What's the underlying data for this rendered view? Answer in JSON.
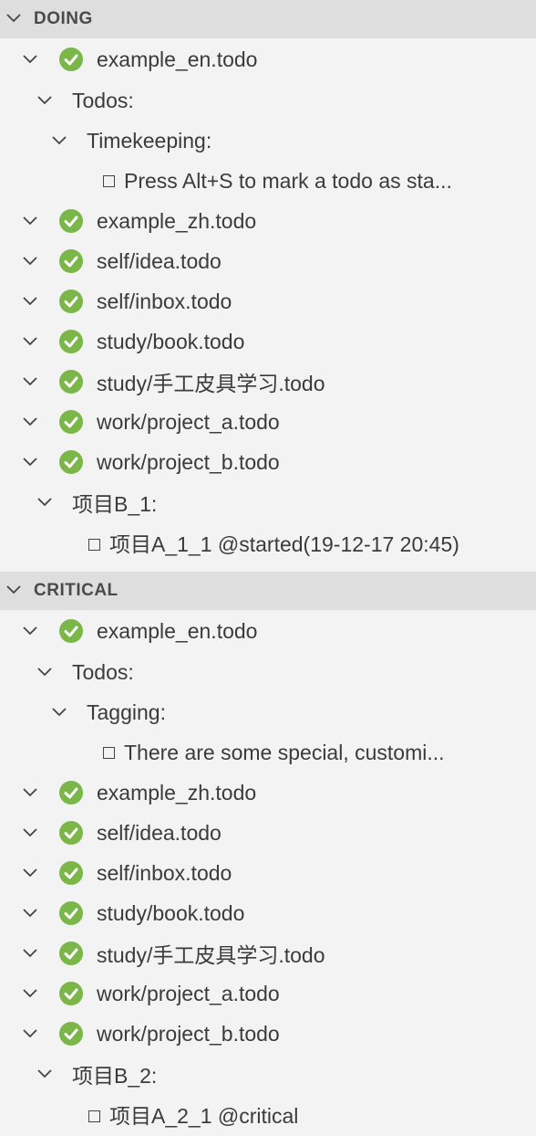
{
  "sections": [
    {
      "title": "DOING",
      "files": [
        "example_en.todo",
        "example_zh.todo",
        "self/idea.todo",
        "self/inbox.todo",
        "study/book.todo",
        "study/手工皮具学习.todo",
        "work/project_a.todo",
        "work/project_b.todo"
      ],
      "example_en": {
        "project": "Todos:",
        "subproject": "Timekeeping:",
        "todo": "Press Alt+S to mark a todo as sta..."
      },
      "project_b": {
        "project": "项目B_1:",
        "todo": "项目A_1_1 @started(19-12-17 20:45)"
      }
    },
    {
      "title": "CRITICAL",
      "files": [
        "example_en.todo",
        "example_zh.todo",
        "self/idea.todo",
        "self/inbox.todo",
        "study/book.todo",
        "study/手工皮具学习.todo",
        "work/project_a.todo",
        "work/project_b.todo"
      ],
      "example_en": {
        "project": "Todos:",
        "subproject": "Tagging:",
        "todo": "There are some special, customi..."
      },
      "project_b": {
        "project": "项目B_2:",
        "todo": "项目A_2_1 @critical"
      }
    }
  ],
  "icons": {
    "file_status": "check-circle-icon",
    "expand": "chevron-down-icon",
    "todo": "checkbox-icon"
  },
  "colors": {
    "check": "#7ab648",
    "header_bg": "#dedede",
    "panel_bg": "#f3f3f3"
  }
}
